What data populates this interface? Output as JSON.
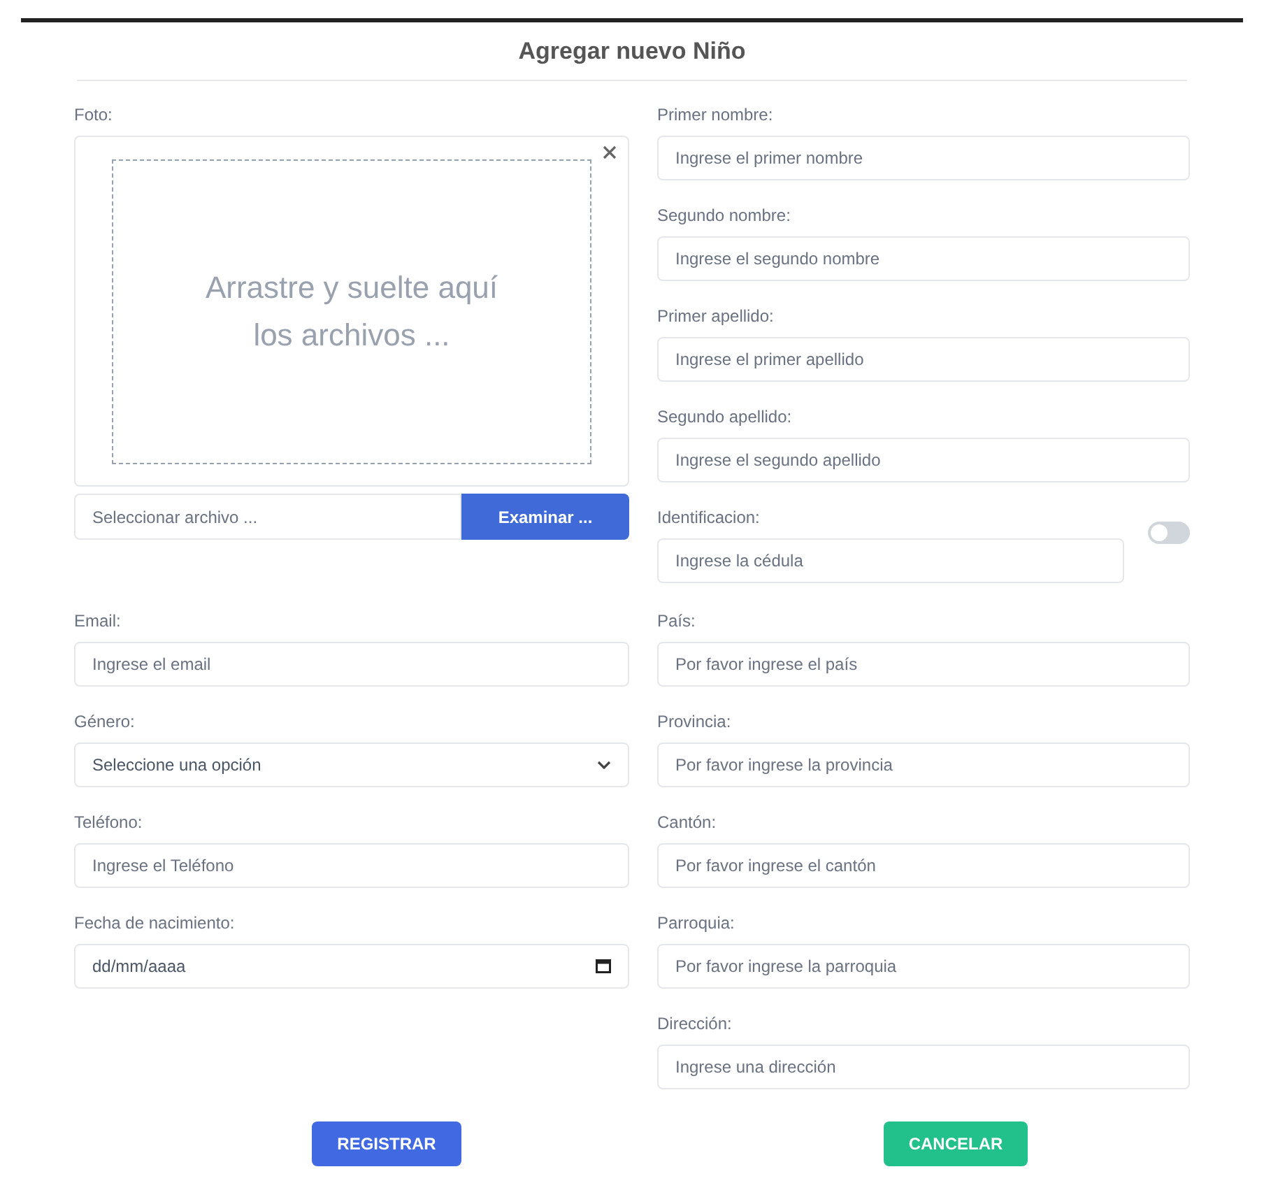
{
  "title": "Agregar nuevo Niño",
  "photo": {
    "label": "Foto:",
    "dropzone_text": "Arrastre y suelte aquí los archivos ...",
    "file_placeholder": "Seleccionar archivo ...",
    "browse_button": "Examinar ..."
  },
  "name_fields": [
    {
      "label": "Primer nombre:",
      "placeholder": "Ingrese el primer nombre"
    },
    {
      "label": "Segundo nombre:",
      "placeholder": "Ingrese el segundo nombre"
    },
    {
      "label": "Primer apellido:",
      "placeholder": "Ingrese el primer apellido"
    },
    {
      "label": "Segundo apellido:",
      "placeholder": "Ingrese el segundo apellido"
    }
  ],
  "identification": {
    "label": "Identificacion:",
    "placeholder": "Ingrese la cédula",
    "toggle_on": false
  },
  "left_fields": [
    {
      "kind": "text",
      "label": "Email:",
      "placeholder": "Ingrese el email"
    },
    {
      "kind": "select",
      "label": "Género:",
      "value": "Seleccione una opción"
    },
    {
      "kind": "text",
      "label": "Teléfono:",
      "placeholder": "Ingrese el Teléfono"
    },
    {
      "kind": "date",
      "label": "Fecha de nacimiento:",
      "value": "dd/mm/aaaa"
    }
  ],
  "right_fields": [
    {
      "label": "País:",
      "placeholder": "Por favor ingrese el país"
    },
    {
      "label": "Provincia:",
      "placeholder": "Por favor ingrese la provincia"
    },
    {
      "label": "Cantón:",
      "placeholder": "Por favor ingrese el cantón"
    },
    {
      "label": "Parroquia:",
      "placeholder": "Por favor ingrese la parroquia"
    },
    {
      "label": "Dirección:",
      "placeholder": "Ingrese una dirección"
    }
  ],
  "buttons": [
    {
      "label": "REGISTRAR",
      "kind": "primary"
    },
    {
      "label": "CANCELAR",
      "kind": "success"
    }
  ]
}
